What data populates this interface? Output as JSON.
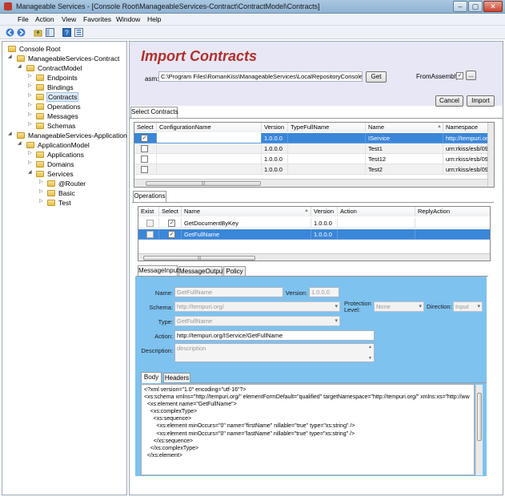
{
  "window": {
    "title": "Manageable Services - [Console Root\\ManageableServices-Contract\\ContractModel\\Contracts]",
    "minimize": "–",
    "maximize": "▢",
    "close": "✕"
  },
  "menu": [
    "File",
    "Action",
    "View",
    "Favorites",
    "Window",
    "Help"
  ],
  "toolbar_icons": [
    "back-icon",
    "forward-icon",
    "up-folder-icon",
    "show-hide-tree-icon",
    "help-icon",
    "properties-icon"
  ],
  "tree": {
    "root": "Console Root",
    "contract": "ManageableServices-Contract",
    "contract_model": "ContractModel",
    "endpoints": "Endpoints",
    "bindings": "Bindings",
    "contracts": "Contracts",
    "operations": "Operations",
    "messages": "Messages",
    "schemas": "Schemas",
    "application": "ManageableServices-Application",
    "application_model": "ApplicationModel",
    "applications": "Applications",
    "domains": "Domains",
    "services": "Services",
    "router": "@Router",
    "basic": "Basic",
    "test": "Test"
  },
  "header": {
    "title": "Import Contracts",
    "asm_label": "asm:",
    "asm_value": "C:\\Program Files\\RomanKiss\\ManageableServices\\LocalRepositoryConsole.dll",
    "get_label": "Get",
    "from_assembly_label": "FromAssembly",
    "browse_label": "...",
    "cancel_label": "Cancel",
    "import_label": "Import"
  },
  "contracts_tab": "Select Contracts",
  "contracts_grid": {
    "columns": [
      "Select",
      "ConfigurationName",
      "Version",
      "TypeFullName",
      "Name",
      "Namespace"
    ],
    "rows": [
      {
        "select": "✓",
        "config": "",
        "version": "1.0.0.0",
        "type": "",
        "name": "IService",
        "ns": "http://tempuri.org/"
      },
      {
        "select": "",
        "config": "",
        "version": "1.0.0.0",
        "type": "",
        "name": "Test1",
        "ns": "urn:rkiss/esb/09"
      },
      {
        "select": "",
        "config": "",
        "version": "1.0.0.0",
        "type": "",
        "name": "Test12",
        "ns": "urn:rkiss/esb/09"
      },
      {
        "select": "",
        "config": "",
        "version": "1.0.0.0",
        "type": "",
        "name": "Test2",
        "ns": "urn:rkiss/esb/09"
      }
    ]
  },
  "operations_tab": "Operations",
  "operations_grid": {
    "columns": [
      "Exist",
      "Select",
      "Name",
      "Version",
      "Action",
      "ReplyAction"
    ],
    "rows": [
      {
        "exist": "",
        "select": "✓",
        "name": "GetDocumentByKey",
        "version": "1.0.0.0",
        "action": "",
        "reply": ""
      },
      {
        "exist": "",
        "select": "✓",
        "name": "GetFullName",
        "version": "1.0.0.0",
        "action": "",
        "reply": ""
      }
    ]
  },
  "message_tabs": [
    "MessageInput",
    "MessageOutput",
    "Policy"
  ],
  "message": {
    "name_label": "Name:",
    "name_value": "GetFullName",
    "version_label": "Version:",
    "version_value": "1.0.0.0",
    "schema_label": "Schema:",
    "schema_value": "http://tempuri.org/",
    "protection_label_1": "Protection",
    "protection_label_2": "Level:",
    "protection_value": "None",
    "direction_label": "Direction:",
    "direction_value": "Input",
    "type_label": "Type:",
    "type_value": "GetFullName",
    "action_label": "Action:",
    "action_value": "http://tempuri.org/IService/GetFullName",
    "description_label": "Description:",
    "description_value": "description"
  },
  "body_tabs": [
    "Body",
    "Headers"
  ],
  "body_lines": [
    "<?xml version=\"1.0\" encoding=\"utf-16\"?>",
    "<xs:schema xmlns=\"http://tempuri.org/\" elementFormDefault=\"qualified\" targetNamespace=\"http://tempuri.org/\" xmlns:xs=\"http://ww",
    "  <xs:element name=\"GetFullName\">",
    "    <xs:complexType>",
    "      <xs:sequence>",
    "        <xs:element minOccurs=\"0\" name=\"firstName\" nillable=\"true\" type=\"xs:string\" />",
    "        <xs:element minOccurs=\"0\" name=\"lastName\" nillable=\"true\" type=\"xs:string\" />",
    "      </xs:sequence>",
    "    </xs:complexType>",
    "  </xs:element>"
  ],
  "colors": {
    "title_red": "#b0302c",
    "selection_blue": "#3a86d8",
    "panel_blue": "#7ec2ef"
  }
}
